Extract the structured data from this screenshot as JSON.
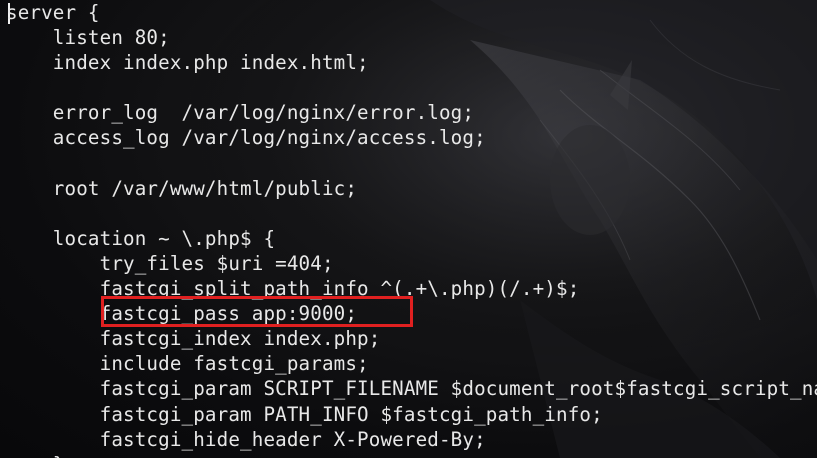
{
  "editor": {
    "lines": [
      "server {",
      "    listen 80;",
      "    index index.php index.html;",
      "",
      "    error_log  /var/log/nginx/error.log;",
      "    access_log /var/log/nginx/access.log;",
      "",
      "    root /var/www/html/public;",
      "",
      "    location ~ \\.php$ {",
      "        try_files $uri =404;",
      "        fastcgi_split_path_info ^(.+\\.php)(/.+)$;",
      "        fastcgi_pass app:9000;",
      "        fastcgi_index index.php;",
      "        include fastcgi_params;",
      "        fastcgi_param SCRIPT_FILENAME $document_root$fastcgi_script_name;",
      "        fastcgi_param PATH_INFO $fastcgi_path_info;",
      "        fastcgi_hide_header X-Powered-By;",
      "    }"
    ]
  },
  "annotation": {
    "highlight_color": "#e02020",
    "highlighted_text": "fastcgi_pass app:9000;"
  }
}
